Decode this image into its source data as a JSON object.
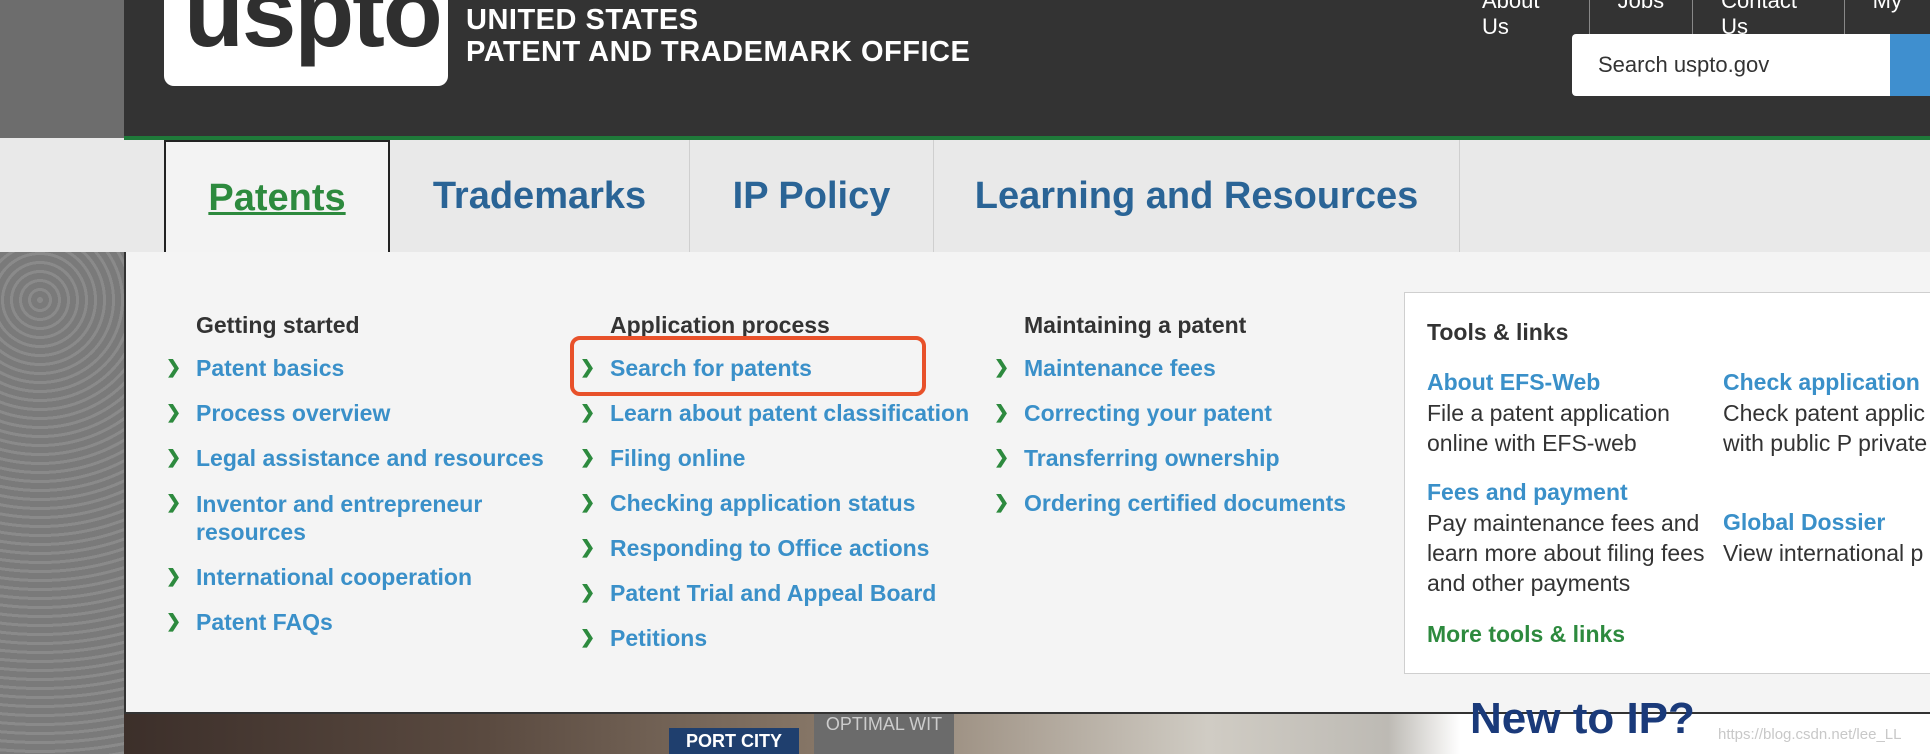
{
  "header": {
    "logo": "uspto",
    "org_line1": "UNITED STATES",
    "org_line2": "PATENT AND TRADEMARK OFFICE",
    "util_nav": [
      "About Us",
      "Jobs",
      "Contact Us",
      "My"
    ],
    "search_placeholder": "Search uspto.gov"
  },
  "tabs": [
    "Patents",
    "Trademarks",
    "IP Policy",
    "Learning and Resources"
  ],
  "menu": {
    "col1": {
      "title": "Getting started",
      "links": [
        "Patent basics",
        "Process overview",
        "Legal assistance and resources",
        "Inventor and entrepreneur resources",
        "International cooperation",
        "Patent FAQs"
      ]
    },
    "col2": {
      "title": "Application process",
      "links": [
        "Search for patents",
        "Learn about patent classification",
        "Filing online",
        "Checking application status",
        "Responding to Office actions",
        "Patent Trial and Appeal Board",
        "Petitions"
      ]
    },
    "col3": {
      "title": "Maintaining a patent",
      "links": [
        "Maintenance fees",
        "Correcting your patent",
        "Transferring ownership",
        "Ordering certified documents"
      ]
    }
  },
  "tools": {
    "title": "Tools & links",
    "items": [
      {
        "title": "About EFS-Web",
        "desc": "File a patent application online with EFS-web"
      },
      {
        "title": "Check application",
        "desc": "Check patent applic status with public P private PAIR"
      },
      {
        "title": "Fees and payment",
        "desc": "Pay maintenance fees and learn more about filing fees and other payments"
      },
      {
        "title": "Global Dossier",
        "desc": "View international p filings"
      }
    ],
    "more": "More tools & links"
  },
  "background": {
    "banner_text": "New to IP?",
    "sign1": "PORT CITY",
    "sign2": "OPTIMAL WIT",
    "watermark": "https://blog.csdn.net/lee_LL"
  },
  "colors": {
    "header_bg": "#333333",
    "link_blue": "#3a90c9",
    "active_green": "#2d8a3e",
    "highlight": "#e8512a"
  }
}
